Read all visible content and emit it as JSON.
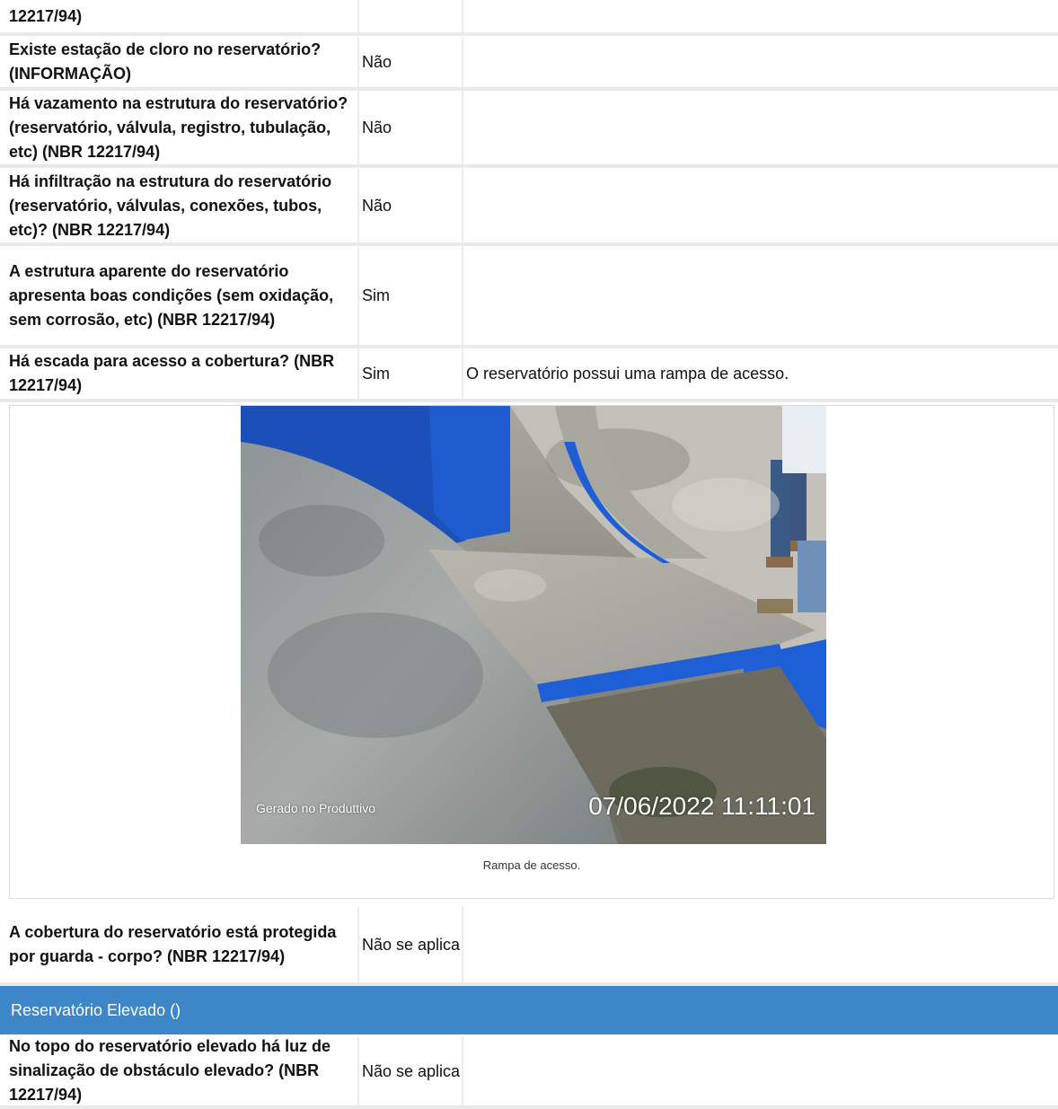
{
  "rows": [
    {
      "question": "12217/94)",
      "answer": "",
      "note": ""
    },
    {
      "question": "Existe estação de cloro no reservatório? (INFORMAÇÃO)",
      "answer": "Não",
      "note": ""
    },
    {
      "question": "Há vazamento na estrutura do reservatório? (reservatório, válvula, registro, tubulação, etc) (NBR 12217/94)",
      "answer": "Não",
      "note": ""
    },
    {
      "question": "Há infiltração na estrutura do reservatório (reservatório, válvulas, conexões, tubos, etc)? (NBR 12217/94)",
      "answer": "Não",
      "note": ""
    },
    {
      "question": "A estrutura aparente do reservatório apresenta boas condições (sem oxidação, sem corrosão, etc) (NBR 12217/94)",
      "answer": "Sim",
      "note": ""
    },
    {
      "question": "Há escada para acesso a cobertura? (NBR 12217/94)",
      "answer": "Sim",
      "note": "O reservatório possui uma rampa de acesso."
    },
    {
      "question": "A cobertura do reservatório está protegida por guarda - corpo? (NBR 12217/94)",
      "answer": "Não se aplica",
      "note": ""
    },
    {
      "question": "No topo do reservatório elevado há luz de sinalização de obstáculo elevado? (NBR 12217/94)",
      "answer": "Não se aplica",
      "note": ""
    }
  ],
  "photo": {
    "watermark": "Gerado no Produttivo",
    "timestamp": "07/06/2022 11:11:01",
    "caption": "Rampa de acesso."
  },
  "section": {
    "title": "Reservatório Elevado ()",
    "color": "#3d87c9"
  }
}
